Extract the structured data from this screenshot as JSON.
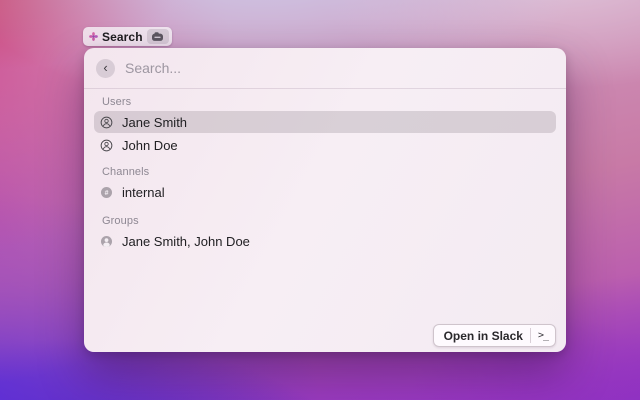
{
  "menu_bar": {
    "app_button": {
      "label": "Search",
      "icon": "flower-icon"
    },
    "badge_icon": "camera-icon",
    "back_glyph": "‹"
  },
  "panel": {
    "search": {
      "placeholder": "Search...",
      "value": ""
    },
    "sections": [
      {
        "label": "Users",
        "items": [
          {
            "label": "Jane Smith",
            "icon": "person-circle-icon",
            "selected": true
          },
          {
            "label": "John Doe",
            "icon": "person-circle-icon",
            "selected": false
          }
        ]
      },
      {
        "label": "Channels",
        "items": [
          {
            "label": "internal",
            "icon": "hash-circle-icon",
            "selected": false
          }
        ]
      },
      {
        "label": "Groups",
        "items": [
          {
            "label": "Jane Smith, John Doe",
            "icon": "people-circle-icon",
            "selected": false
          }
        ]
      }
    ],
    "action_bar": {
      "open_button": {
        "label": "Open in Slack",
        "shortcut_glyph": ">_"
      }
    }
  },
  "colors": {
    "selection_bg": "#d9d3d8",
    "panel_bg": "#f5ecf2",
    "wallpaper_pink": "#cf4f92",
    "wallpaper_violet": "#5c2ed8",
    "wallpaper_purple": "#8e2fc4",
    "wallpaper_periwinkle": "#cdc9e8",
    "wallpaper_rose": "#c87aa6"
  }
}
